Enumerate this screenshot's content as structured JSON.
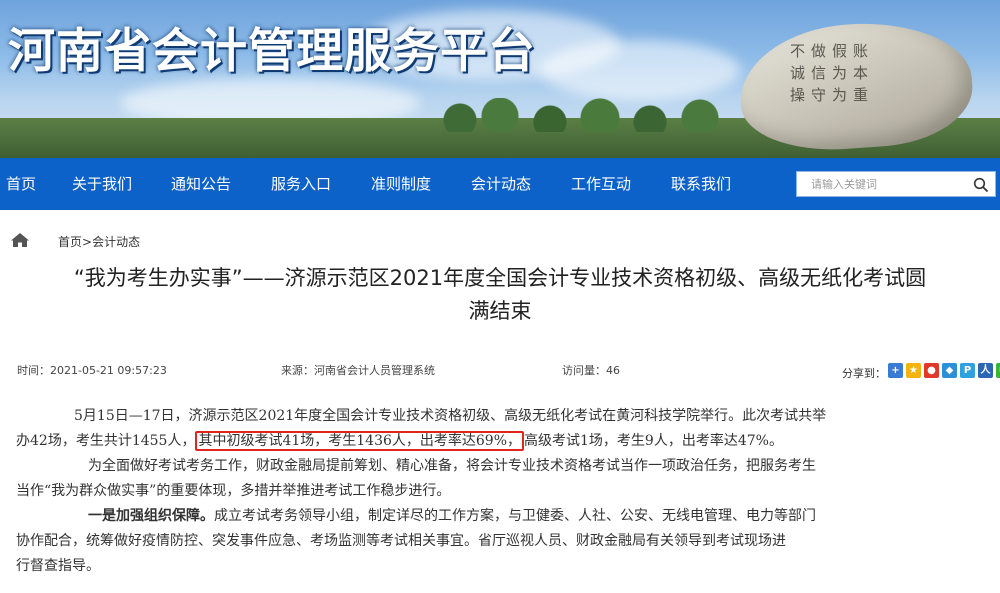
{
  "site": {
    "title": "河南省会计管理服务平台"
  },
  "nav": {
    "items": [
      "首页",
      "关于我们",
      "通知公告",
      "服务入口",
      "准则制度",
      "会计动态",
      "工作互动",
      "联系我们"
    ],
    "search_placeholder": "请输入关键词"
  },
  "breadcrumb": {
    "home": "首页",
    "sep": ">",
    "current": "会计动态"
  },
  "article": {
    "title_line1": "“我为考生办实事”——济源示范区2021年度全国会计专业技术资格初级、高级无纸化考试圆",
    "title_line2": "满结束",
    "meta": {
      "time": "时间：2021-05-21 09:57:23",
      "source": "来源：河南省会计人员管理系统",
      "views": "访问量：46"
    },
    "share_label": "分享到：",
    "paragraphs": {
      "p1_a": "5月15日—17日，济源示范区2021年度全国会计专业技术资格初级、高级无纸化考试在黄河科技学院举行。此次考试共举",
      "p1_b": "办42场，考生共计1455人，",
      "p1_highlight": "其中初级考试41场，考生1436人，出考率达69%，",
      "p1_c": "高级考试1场，考生9人，出考率达47%。",
      "p2_a": "为全面做好考试考务工作，财政金融局提前筹划、精心准备，将会计专业技术资格考试当作一项政治任务，把服务考生",
      "p2_b": "当作“我为群众做实事”的重要体现，多措并举推进考试工作稳步进行。",
      "p3_strong": "一是加强组织保障。",
      "p3_a": "成立考试考务领导小组，制定详尽的工作方案，与卫健委、人社、公安、无线电管理、电力等部门",
      "p3_b": "协作配合，统筹做好疫情防控、突发事件应急、考场监测等考试相关事宜。省厅巡视人员、财政金融局有关领导到考试现场进",
      "p3_c": "行督查指导。"
    }
  },
  "share_icons": [
    {
      "name": "share-more-icon",
      "color": "#3a7bd5"
    },
    {
      "name": "share-qzone-icon",
      "color": "#f3b40f"
    },
    {
      "name": "share-weibo-icon",
      "color": "#e2372b"
    },
    {
      "name": "share-tencent-weibo-icon",
      "color": "#2d8fd7"
    },
    {
      "name": "share-pengyou-icon",
      "color": "#2fa1e0"
    },
    {
      "name": "share-renren-icon",
      "color": "#2c67b5"
    },
    {
      "name": "share-wechat-icon",
      "color": "#3bb336"
    }
  ]
}
